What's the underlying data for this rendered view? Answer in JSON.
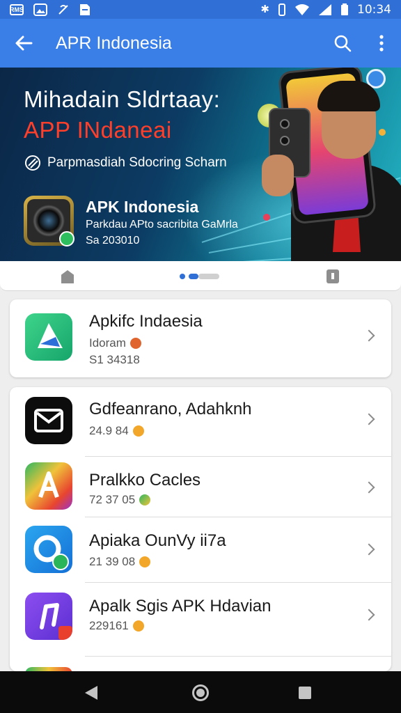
{
  "status_bar": {
    "left_box_label": "RMS",
    "time": "10:34",
    "icons": [
      "sim-card-icon",
      "image-icon",
      "no-signal-icon",
      "document-icon",
      "bluetooth-icon",
      "vibrate-icon",
      "wifi-icon",
      "cell-signal-icon",
      "battery-icon"
    ]
  },
  "app_bar": {
    "title": "APR Indonesia",
    "icons": [
      "back-arrow-icon",
      "search-icon",
      "more-vertical-icon"
    ]
  },
  "banner": {
    "title_line1": "Mihadain Sldrtaay:",
    "title_line2": "APP INdaneai",
    "subtitle": "Parpmasdiah Sdocring Scharn",
    "app_name": "APK Indonesia",
    "description_line1": "Parkdau APto sacribita GaMrla",
    "description_line2": "Sa 203010",
    "colors": {
      "title_accent": "#ff3f2a"
    }
  },
  "pager": {
    "current_page": 2,
    "icons": [
      "home-icon",
      "document-icon"
    ]
  },
  "featured": {
    "name": "Apkifc Indaesia",
    "meta_line1": "Idoram",
    "meta_line2": "S1 34318",
    "icon": "triangle-app-icon"
  },
  "apps": [
    {
      "name": "Gdfeanrano, Adahknh",
      "meta": "24.9 84",
      "icon": "mail-app-icon"
    },
    {
      "name": "Pralkko Cacles",
      "meta": "72 37 05",
      "icon": "letter-a-app-icon"
    },
    {
      "name": "Apiaka OunVy ii7a",
      "meta": "21 39 08",
      "icon": "ring-app-icon"
    },
    {
      "name": "Apalk Sgis APK Hdavian",
      "meta": "229161",
      "icon": "music-note-app-icon"
    }
  ],
  "navigation": {
    "icons": [
      "nav-back-icon",
      "nav-home-icon",
      "nav-recents-icon"
    ]
  },
  "colors": {
    "primary": "#3a7ee8",
    "status_bar": "#2f6fd6",
    "nav_bar": "#0b0b0b"
  }
}
